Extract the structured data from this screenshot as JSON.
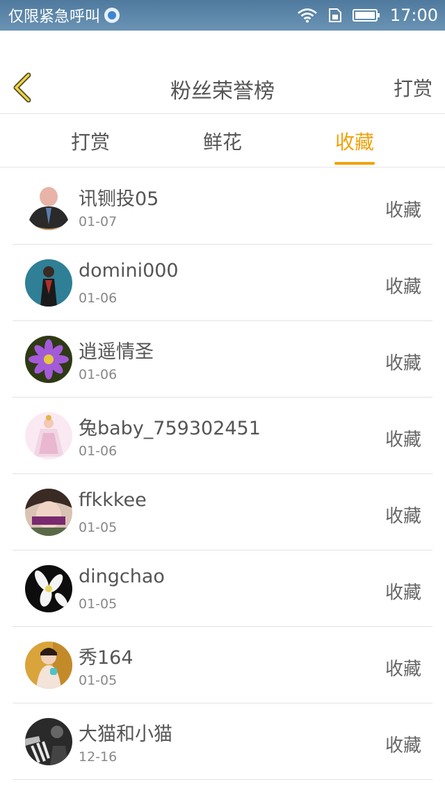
{
  "status_bar": {
    "left_text": "仅限紧急呼叫",
    "time": "17:00"
  },
  "header": {
    "title": "粉丝荣誉榜",
    "action_label": "打赏",
    "back_icon": "chevron-left-icon",
    "accent_color": "#f0a20a"
  },
  "tabs": [
    {
      "label": "打赏",
      "active": false
    },
    {
      "label": "鲜花",
      "active": false
    },
    {
      "label": "收藏",
      "active": true
    }
  ],
  "list": {
    "items": [
      {
        "name": "讯铡投05",
        "date": "01-07",
        "action": "收藏"
      },
      {
        "name": "domini000",
        "date": "01-06",
        "action": "收藏"
      },
      {
        "name": "逍遥情圣",
        "date": "01-06",
        "action": "收藏"
      },
      {
        "name": "兔baby_759302451",
        "date": "01-06",
        "action": "收藏"
      },
      {
        "name": "ffkkkee",
        "date": "01-05",
        "action": "收藏"
      },
      {
        "name": "dingchao",
        "date": "01-05",
        "action": "收藏"
      },
      {
        "name": "秀164",
        "date": "01-05",
        "action": "收藏"
      },
      {
        "name": "大猫和小猫",
        "date": "12-16",
        "action": "收藏"
      }
    ]
  }
}
